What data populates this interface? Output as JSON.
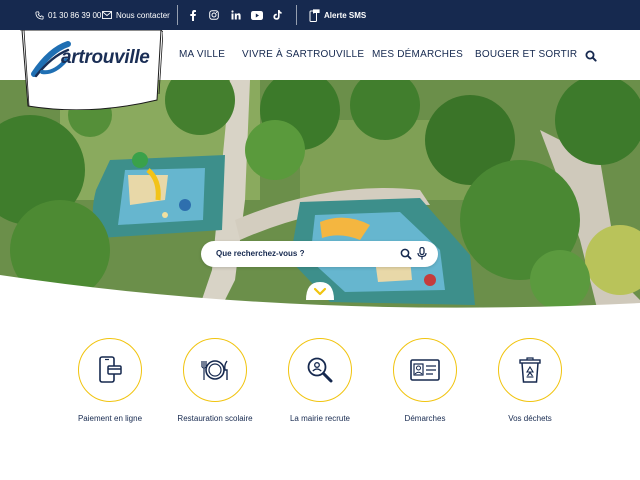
{
  "topbar": {
    "phone": "01 30 86 39 00",
    "contact_label": "Nous contacter",
    "social": [
      "facebook-icon",
      "instagram-icon",
      "linkedin-icon",
      "youtube-icon",
      "tiktok-icon"
    ],
    "sms_label": "Alerte SMS"
  },
  "logo": {
    "text": "artrouville"
  },
  "nav": {
    "items": [
      "MA VILLE",
      "VIVRE À SARTROUVILLE",
      "MES DÉMARCHES",
      "BOUGER ET SORTIR"
    ]
  },
  "search": {
    "placeholder": "Que recherchez-vous ?"
  },
  "quick_access": [
    {
      "label": "Paiement en ligne",
      "icon": "phone-payment-icon"
    },
    {
      "label": "Restauration scolaire",
      "icon": "plate-cutlery-icon"
    },
    {
      "label": "La mairie recrute",
      "icon": "recruit-magnifier-icon"
    },
    {
      "label": "Démarches",
      "icon": "id-card-icon"
    },
    {
      "label": "Vos déchets",
      "icon": "recycle-bin-icon"
    }
  ],
  "colors": {
    "navy": "#16294f",
    "accent": "#f1c40f",
    "logo_blue": "#1f6fb3"
  }
}
